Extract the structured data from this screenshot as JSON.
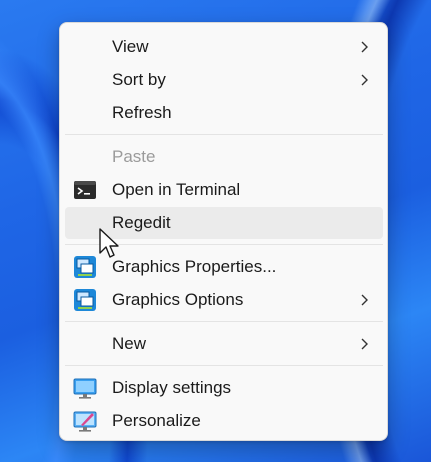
{
  "menu": {
    "items": [
      {
        "label": "View",
        "submenu": true
      },
      {
        "label": "Sort by",
        "submenu": true
      },
      {
        "label": "Refresh",
        "submenu": false
      },
      {
        "label": "Paste",
        "disabled": true
      },
      {
        "label": "Open in Terminal",
        "icon": "terminal-icon"
      },
      {
        "label": "Regedit",
        "hovered": true
      },
      {
        "label": "Graphics Properties...",
        "icon": "intel-graphics-icon"
      },
      {
        "label": "Graphics Options",
        "icon": "intel-graphics-icon",
        "submenu": true
      },
      {
        "label": "New",
        "submenu": true
      },
      {
        "label": "Display settings",
        "icon": "display-icon"
      },
      {
        "label": "Personalize",
        "icon": "personalize-icon"
      }
    ]
  },
  "colors": {
    "menu_bg": "#f9f9f9",
    "hover_bg": "#ebebeb",
    "text": "#1b1b1b",
    "disabled_text": "#9b9b9b",
    "wallpaper_blue": "#1f66e6"
  }
}
